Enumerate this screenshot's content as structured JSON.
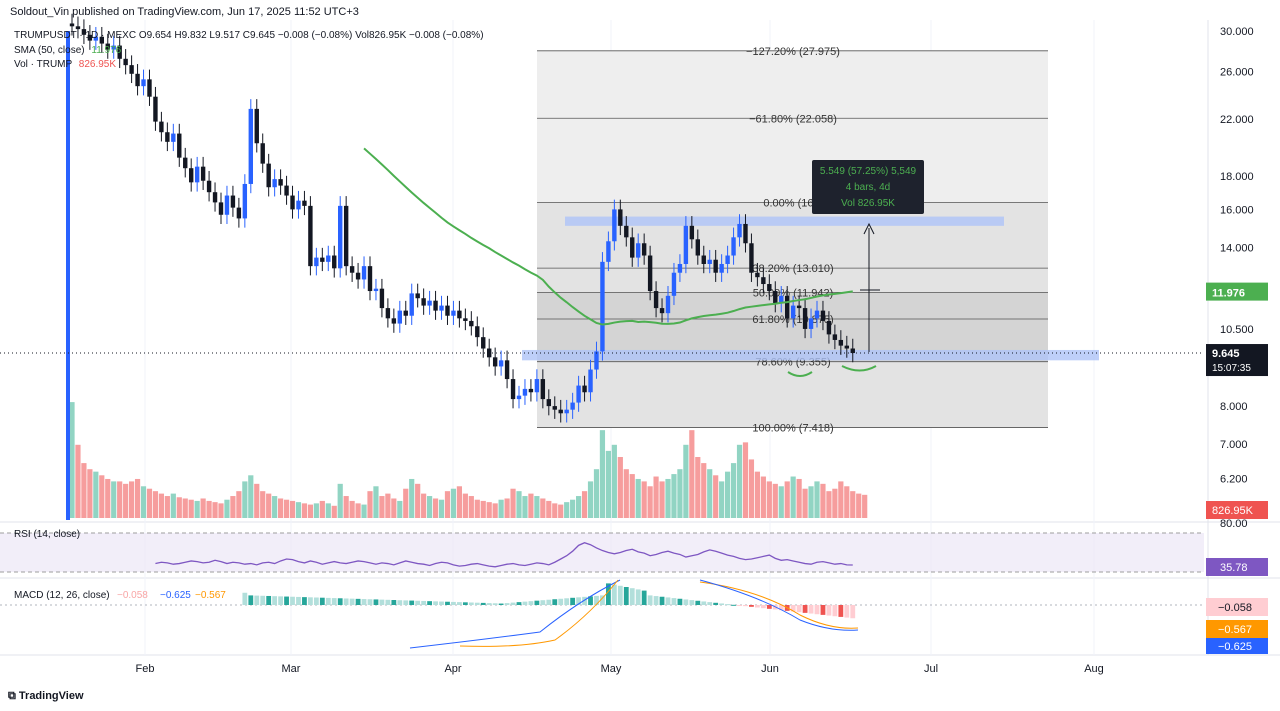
{
  "header": {
    "published": "Soldout_Vin published on TradingView.com, Jun 17, 2025 11:52 UTC+3",
    "symbol_line": "TRUMPUSDT · 1D · MEXC  O9.654  H9.832  L9.517  C9.645  −0.008 (−0.08%)  Vol826.95K  −0.008 (−0.08%)",
    "sma_label": "SMA (50, close)",
    "sma_value": "11.976",
    "vol_label": "Vol · TRUMP",
    "vol_value": "826.95K"
  },
  "footer": {
    "brand": "TradingView"
  },
  "colors": {
    "up": "#2962ff",
    "down": "#131722",
    "sma": "#4caf50",
    "vol_up": "#7ecdb9",
    "vol_down": "#f48c8c",
    "rsi": "#7e57c2",
    "macd_line": "#2962ff",
    "signal_line": "#ff9800",
    "fib_zone": "#d9d9d9",
    "support_band": "#aec3f7"
  },
  "chart_data": {
    "type": "candlestick",
    "title": "",
    "price_axis": {
      "scale": "log",
      "ticks": [
        "30.000",
        "26.000",
        "22.000",
        "18.000",
        "16.000",
        "14.000",
        "10.500",
        "8.000",
        "7.000",
        "6.200"
      ],
      "last_price": "9.645",
      "countdown": "15:07:35",
      "sma_tag": "11.976",
      "vol_tag": "826.95K"
    },
    "time_axis": {
      "ticks": [
        "Feb",
        "Mar",
        "Apr",
        "May",
        "Jun",
        "Jul",
        "Aug"
      ]
    },
    "fib_levels": [
      {
        "ratio": "-127.20%",
        "price": 27.975,
        "label": "−127.20% (27.975)"
      },
      {
        "ratio": "-61.80%",
        "price": 22.058,
        "label": "−61.80% (22.058)"
      },
      {
        "ratio": "0.00%",
        "price": 16.4,
        "label": "0.00% (16.4"
      },
      {
        "ratio": "38.20%",
        "price": 13.01,
        "label": "38.20% (13.010)"
      },
      {
        "ratio": "50.00%",
        "price": 11.942,
        "label": "50.00% (11.942)"
      },
      {
        "ratio": "61.80%",
        "price": 10.875,
        "label": "61.80% (10.875)"
      },
      {
        "ratio": "78.60%",
        "price": 9.355,
        "label": "78.60% (9.355)"
      },
      {
        "ratio": "100.00%",
        "price": 7.418,
        "label": "100.00% (7.418)"
      }
    ],
    "measure_box": {
      "line1": "5.549 (57.25%) 5,549",
      "line2": "4 bars, 4d",
      "line3": "Vol 826.95K"
    },
    "resistance_zone": [
      15.1,
      15.6
    ],
    "support_zone": [
      9.4,
      9.75
    ],
    "close_series": [
      30.5,
      30.2,
      29.6,
      29.0,
      29.4,
      28.7,
      28.1,
      28.5,
      27.2,
      26.6,
      25.8,
      24.7,
      25.3,
      23.8,
      21.8,
      21.0,
      20.3,
      20.9,
      19.2,
      18.5,
      17.6,
      18.6,
      17.7,
      17.0,
      16.4,
      15.7,
      16.8,
      16.1,
      15.5,
      17.5,
      22.8,
      20.2,
      18.8,
      17.3,
      17.8,
      17.4,
      16.8,
      16.0,
      16.5,
      16.2,
      13.1,
      13.5,
      13.3,
      13.6,
      13.0,
      16.2,
      13.1,
      12.8,
      12.5,
      13.1,
      12.0,
      12.1,
      11.3,
      10.9,
      10.7,
      11.2,
      11.0,
      11.9,
      11.7,
      11.4,
      11.6,
      11.2,
      11.4,
      11.0,
      11.2,
      10.9,
      10.8,
      10.6,
      10.2,
      9.8,
      9.5,
      9.2,
      9.4,
      8.8,
      8.2,
      8.3,
      8.5,
      8.4,
      8.8,
      8.2,
      8.0,
      7.9,
      7.8,
      7.9,
      8.1,
      8.6,
      8.4,
      9.1,
      9.7,
      13.3,
      14.3,
      16.0,
      15.1,
      14.5,
      13.5,
      14.2,
      13.6,
      12.0,
      11.3,
      11.1,
      11.8,
      12.8,
      13.2,
      15.1,
      14.4,
      13.6,
      13.2,
      13.4,
      12.8,
      13.2,
      13.6,
      14.5,
      15.2,
      14.2,
      12.8,
      12.6,
      12.3,
      12.0,
      11.5,
      11.8,
      10.9,
      11.4,
      11.3,
      10.5,
      10.9,
      11.2,
      10.8,
      10.3,
      10.1,
      9.9,
      9.8,
      9.645
    ],
    "sma_start_index": 49,
    "volume_k": [
      95,
      60,
      45,
      40,
      38,
      35,
      32,
      30,
      30,
      28,
      30,
      32,
      26,
      24,
      22,
      20,
      18,
      20,
      17,
      16,
      15,
      14,
      16,
      14,
      13,
      12,
      15,
      18,
      22,
      30,
      35,
      28,
      22,
      20,
      18,
      16,
      15,
      14,
      13,
      12,
      11,
      12,
      14,
      12,
      10,
      28,
      18,
      14,
      12,
      11,
      22,
      26,
      18,
      20,
      16,
      14,
      24,
      32,
      28,
      20,
      18,
      16,
      15,
      22,
      24,
      26,
      20,
      18,
      15,
      14,
      13,
      12,
      15,
      16,
      24,
      22,
      18,
      20,
      18,
      16,
      14,
      12,
      11,
      13,
      15,
      18,
      22,
      30,
      40,
      72,
      55,
      60,
      50,
      40,
      36,
      32,
      30,
      26,
      34,
      30,
      32,
      36,
      40,
      60,
      72,
      50,
      45,
      40,
      35,
      30,
      38,
      45,
      60,
      62,
      48,
      38,
      34,
      30,
      28,
      26,
      30,
      34,
      32,
      24,
      26,
      30,
      28,
      22,
      24,
      30,
      26,
      22,
      20,
      19
    ],
    "rsi": {
      "label": "RSI (14, close)",
      "value": "35.78",
      "axis_top": "80.00",
      "series": [
        38,
        40,
        39,
        37,
        38,
        40,
        42,
        41,
        39,
        40,
        43,
        41,
        38,
        40,
        39,
        37,
        38,
        36,
        39,
        40,
        38,
        42,
        45,
        44,
        41,
        39,
        42,
        40,
        37,
        39,
        41,
        39,
        38,
        40,
        42,
        41,
        39,
        37,
        39,
        38,
        36,
        39,
        42,
        40,
        38,
        37,
        35,
        38,
        40,
        39,
        36,
        34,
        35,
        37,
        38,
        36,
        34,
        33,
        35,
        37,
        38,
        36,
        35,
        37,
        39,
        38,
        36,
        40,
        45,
        50,
        57,
        66,
        70,
        67,
        62,
        58,
        55,
        53,
        55,
        58,
        60,
        56,
        54,
        50,
        52,
        55,
        57,
        54,
        52,
        48,
        50,
        52,
        56,
        59,
        57,
        54,
        51,
        49,
        46,
        44,
        45,
        47,
        49,
        51,
        46,
        43,
        44,
        42,
        40,
        38,
        37,
        40,
        41,
        39,
        37,
        38,
        36,
        35.78
      ]
    },
    "macd": {
      "label": "MACD (12, 26, close)",
      "hist_value": "−0.058",
      "signal_value": "−0.567",
      "macd_value": "−0.625",
      "params_values": [
        "−0.058",
        "−0.625",
        "−0.567"
      ]
    }
  }
}
